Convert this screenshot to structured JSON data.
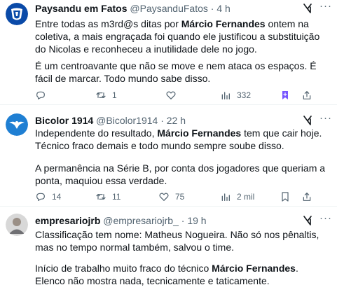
{
  "tweets": [
    {
      "display_name": "Paysandu em Fatos",
      "handle": "@PaysanduFatos",
      "dot": "·",
      "time": "4 h",
      "p1_a": "Entre todas as m3rd@s ditas por ",
      "p1_b": "Márcio Fernandes",
      "p1_c": " ontem na coletiva, a mais engraçada foi quando ele justificou a substituição do Nicolas e reconheceu a inutilidade dele no jogo.",
      "p2": "É um centroavante que não se move e nem ataca os espaços. É fácil de marcar. Todo mundo sabe disso.",
      "replies": "",
      "retweets": "1",
      "likes": "",
      "views": "332",
      "more": "···",
      "avatar_colors": [
        "#0a4aa8",
        "#ffffff"
      ]
    },
    {
      "display_name": "Bicolor 1914",
      "handle": "@Bicolor1914",
      "dot": "·",
      "time": "22 h",
      "p1_a": "Independente do resultado, ",
      "p1_b": "Márcio Fernandes",
      "p1_c": " tem que cair hoje. Técnico fraco demais e todo mundo sempre soube disso.",
      "p2": "A permanência na Série B, por conta dos jogadores que queriam a ponta, maquiou essa verdade.",
      "replies": "14",
      "retweets": "11",
      "likes": "75",
      "views": "2 mil",
      "more": "···",
      "avatar_colors": [
        "#1f7fd3",
        "#ffffff"
      ]
    },
    {
      "display_name": "empresariojrb",
      "handle": "@empresariojrb_",
      "dot": "·",
      "time": "19 h",
      "p1_a": "Classificação tem nome: Matheus Nogueira. Não só nos pênaltis, mas no tempo normal também, salvou o time.",
      "p2_a": "Início de trabalho muito fraco do técnico ",
      "p2_b": "Márcio Fernandes",
      "p2_c": ". Elenco não mostra nada, tecnicamente e taticamente.",
      "more": "···",
      "avatar_colors": [
        "#c9c9c9",
        "#8a8a8a"
      ]
    }
  ],
  "colors": {
    "text": "#0f1419",
    "muted": "#536471",
    "bookmark_active": "#7856ff",
    "divider": "#eff3f4"
  }
}
